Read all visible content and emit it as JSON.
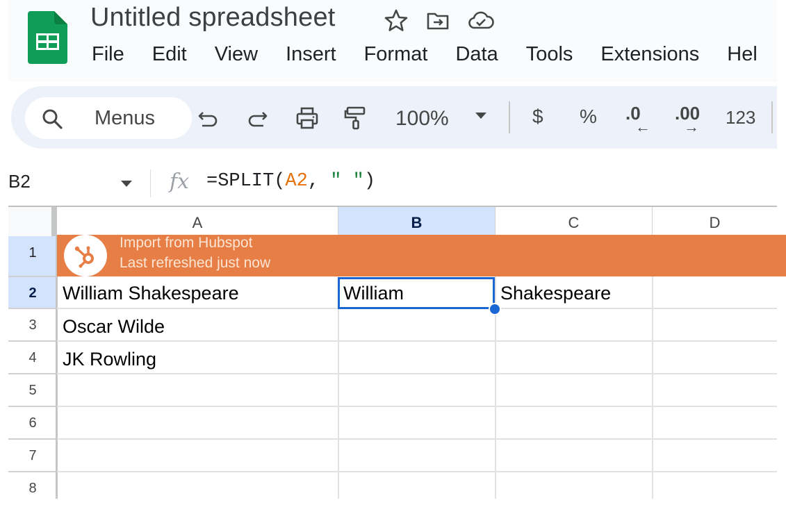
{
  "app": {
    "title": "Untitled spreadsheet",
    "brand_color": "#0f9d58"
  },
  "menubar": {
    "items": [
      "File",
      "Edit",
      "View",
      "Insert",
      "Format",
      "Data",
      "Tools",
      "Extensions",
      "Hel"
    ]
  },
  "toolbar": {
    "search_label": "Menus",
    "zoom": "100%",
    "currency": "$",
    "percent": "%",
    "decrease_decimal": ".0",
    "increase_decimal": ".00",
    "number_format": "123",
    "icons": [
      "search-icon",
      "undo-icon",
      "redo-icon",
      "print-icon",
      "paint-format-icon"
    ]
  },
  "formula_bar": {
    "name_box": "B2",
    "fx": "fx",
    "formula_prefix": "=SPLIT(",
    "formula_ref": "A2",
    "formula_sep": ", ",
    "formula_str": "\" \"",
    "formula_suffix": ")"
  },
  "grid": {
    "columns": [
      "A",
      "B",
      "C",
      "D"
    ],
    "selected_column": "B",
    "rows": [
      "1",
      "2",
      "3",
      "4",
      "5",
      "6",
      "7",
      "8"
    ],
    "selected_row": "2",
    "selected_cell": "B2",
    "cells": {
      "A2": "William Shakespeare",
      "B2": "William",
      "C2": "Shakespeare",
      "A3": "Oscar Wilde",
      "A4": "JK Rowling"
    }
  },
  "banner": {
    "line1": "Import from Hubspot",
    "line2": "Last refreshed just now",
    "color": "#e67e45"
  },
  "colors": {
    "selection": "#1a66d2",
    "header_selected": "#d3e3fd",
    "formula_ref": "#e8710a",
    "formula_string": "#188038"
  }
}
